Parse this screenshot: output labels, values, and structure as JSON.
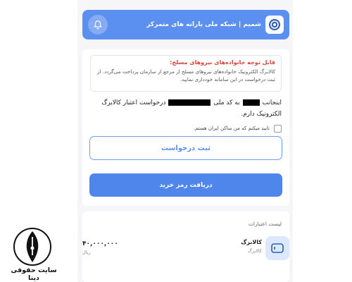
{
  "header": {
    "title": "شمیم | شبکه ملی یارانه های متمرکز",
    "bell_icon": "bell-icon",
    "logo_icon": "shamim-logo-icon",
    "accent": "#5b8ff0"
  },
  "notice": {
    "title": "قابل توجه خانواده‌های نیروهای مسلح:",
    "body": "کالابرگ الکترونیک خانواده‌های نیروهای مسلح از مرجع از سازمان پرداخت می‌گردد. از ثبت درخواست در این سامانه خودداری نمایید.",
    "title_color": "#e0413a"
  },
  "request": {
    "part1": "اینجانب",
    "part2": "به کد ملی",
    "part3": "درخواست اعتبار کالابرگ الکترونیک دارم."
  },
  "consent": {
    "label": "تایید میکنم که من ساکن ایران هستم."
  },
  "buttons": {
    "submit": "ثبت درخواست",
    "get_password": "دریافت رمز خرید"
  },
  "credits": {
    "title": "لیست اعتبارات",
    "items": [
      {
        "name": "کالابرگ",
        "sub": "کالابرگ",
        "amount": "۴۰,۰۰۰,۰۰۰",
        "currency": "ریال",
        "icon": "card-icon"
      }
    ]
  },
  "watermark": {
    "text": "سایت حقوقی دینا",
    "icon": "pen-nib-icon"
  }
}
